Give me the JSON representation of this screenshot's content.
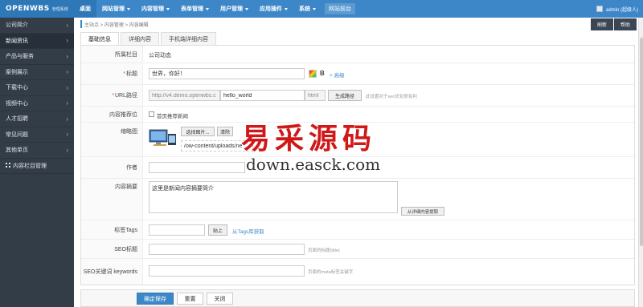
{
  "brand": {
    "logo": "OPENWBS",
    "sub": "管理系统"
  },
  "nav": [
    {
      "label": "桌面",
      "dropdown": false
    },
    {
      "label": "网站管理",
      "dropdown": true
    },
    {
      "label": "内容管理",
      "dropdown": true
    },
    {
      "label": "表单管理",
      "dropdown": true
    },
    {
      "label": "用户管理",
      "dropdown": true
    },
    {
      "label": "应用插件",
      "dropdown": true
    },
    {
      "label": "系统",
      "dropdown": true
    }
  ],
  "nav_site": "网站前台",
  "user": {
    "name": "admin (超级人)"
  },
  "sidebar": [
    "公司简介",
    "新闻资讯",
    "产品与服务",
    "案例展示",
    "下载中心",
    "视频中心",
    "人才招聘",
    "常见问题",
    "其他单页",
    "内容栏目管理"
  ],
  "breadcrumb": "主站点 > 内容管理 > 内容编辑",
  "toolbar": {
    "refresh": "刷新",
    "help": "帮助"
  },
  "tabs": [
    "基础信息",
    "详细内容",
    "手机端详细内容"
  ],
  "form": {
    "category": {
      "label": "所属栏目",
      "value": "公司动态"
    },
    "title": {
      "label": "标题",
      "value": "世界，你好！",
      "bold": "B",
      "advanced": "+ 高级"
    },
    "url": {
      "label": "URL路径",
      "prefix": "http://v4.demo.openwbs.c",
      "value": "hello_world",
      "suffix": "html",
      "gen_button": "生成路径",
      "hint": "此设置对于seo优化很有利"
    },
    "recommend": {
      "label": "内容推荐位",
      "option": "首页推荐新闻"
    },
    "thumb": {
      "label": "缩略图",
      "choose": "选择图片...",
      "clear": "清除",
      "path": "/ow-content/uploads/ne"
    },
    "author": {
      "label": "作者",
      "value": ""
    },
    "summary": {
      "label": "内容摘要",
      "value": "这里是新闻内容摘要简介",
      "extract": "从详细内容提取"
    },
    "tags": {
      "label": "标签Tags",
      "value": "",
      "paste": "贴上",
      "from_lib": "从Tags库获取"
    },
    "seo_title": {
      "label": "SEO标题",
      "value": "",
      "hint": "页面的标题(title)"
    },
    "seo_keywords": {
      "label": "SEO关键词 keywords",
      "value": "",
      "hint": "页面的meta标签关键字"
    }
  },
  "footer": {
    "save": "确定保存",
    "reset": "重置",
    "close": "关闭"
  },
  "watermark": {
    "cn": "易采源码",
    "en": "down.easck.com"
  }
}
